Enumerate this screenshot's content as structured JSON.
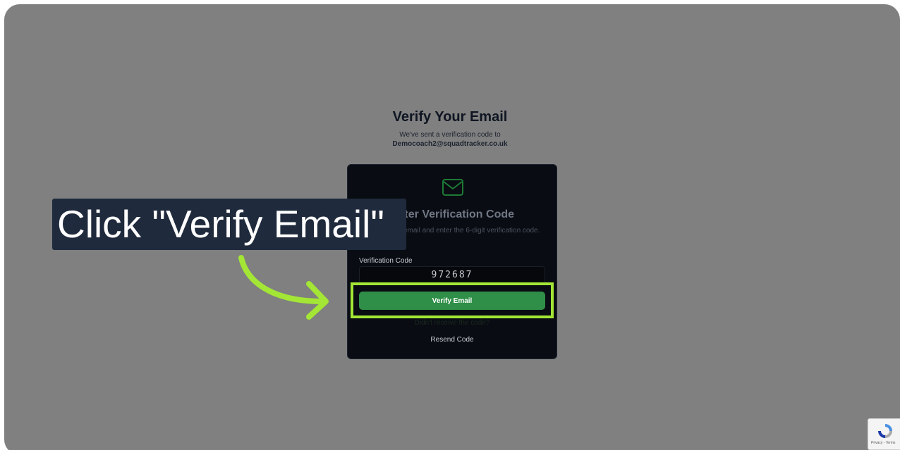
{
  "page": {
    "title": "Verify Your Email",
    "subtitle": "We've sent a verification code to",
    "email": "Democoach2@squadtracker.co.uk"
  },
  "card": {
    "icon": "mail-icon",
    "heading": "Enter Verification Code",
    "description": "Check your email and enter the 6-digit verification code.",
    "code_label": "Verification Code",
    "code_value": "972687",
    "verify_button": "Verify Email",
    "resend_prompt": "Didn't receive the code?",
    "resend_link": "Resend Code"
  },
  "annotation": {
    "callout_text": "Click \"Verify Email\"",
    "highlight_color": "#a3e635",
    "callout_bg": "#1f2a3c"
  },
  "recaptcha": {
    "icon": "recaptcha-icon",
    "links": "Privacy - Terms"
  },
  "colors": {
    "overlay": "#7f807f",
    "button": "#2f8e47",
    "card_bg": "#090c12"
  }
}
